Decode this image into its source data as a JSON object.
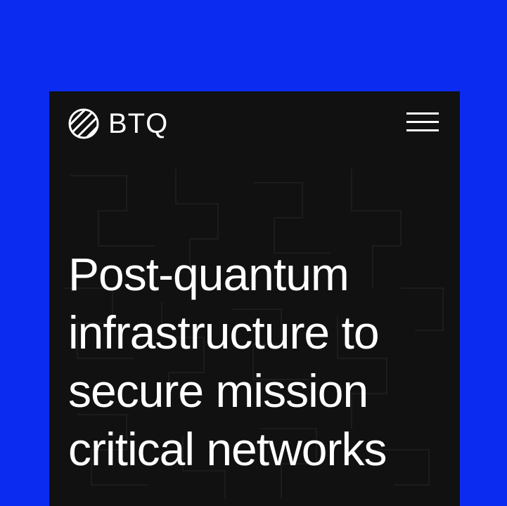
{
  "brand": {
    "name": "BTQ",
    "logo_icon": "striped-globe-icon"
  },
  "nav": {
    "menu_icon": "hamburger-menu-icon"
  },
  "hero": {
    "headline_lines": [
      "Post-quantum",
      "infrastructure to",
      "secure mission",
      "critical networks"
    ]
  },
  "colors": {
    "background_accent": "#0b2cf0",
    "panel": "#111111",
    "text": "#ffffff"
  }
}
